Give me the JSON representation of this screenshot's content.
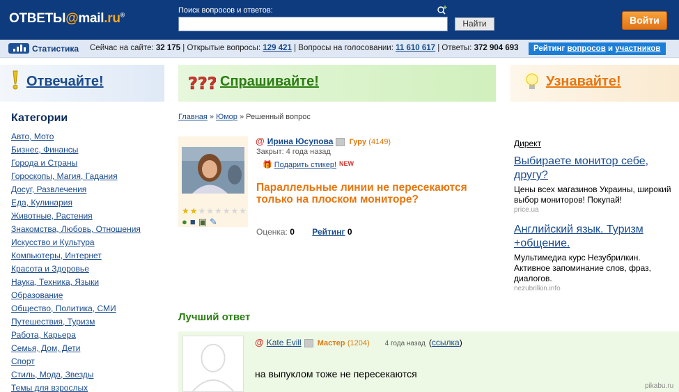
{
  "header": {
    "logo_text": "ОТВЕТЫ",
    "logo_at": "@",
    "logo_mail": "mail",
    "logo_ru": ".ru",
    "logo_reg": "®",
    "search_label": "Поиск вопросов и ответов:",
    "search_value": "",
    "search_button": "Найти",
    "login_button": "Войти"
  },
  "statbar": {
    "title": "Статистика",
    "online_label": "Сейчас на сайте:",
    "online_value": "32 175",
    "open_label": "Открытые вопросы:",
    "open_value": "129 421",
    "voting_label": "Вопросы на голосовании:",
    "voting_value": "11 610 617",
    "answers_label": "Ответы:",
    "answers_value": "372 904 693",
    "rating_prefix": "Рейтинг",
    "rating_questions": "вопросов",
    "rating_and": "и",
    "rating_users": "участников"
  },
  "banners": {
    "answer": "Отвечайте!",
    "ask": "Спрашивайте!",
    "learn": "Узнавайте!"
  },
  "sidebar": {
    "title": "Категории",
    "items": [
      "Авто, Мото",
      "Бизнес, Финансы",
      "Города и Страны",
      "Гороскопы, Магия, Гадания",
      "Досуг, Развлечения",
      "Еда, Кулинария",
      "Животные, Растения",
      "Знакомства, Любовь, Отношения",
      "Искусство и Культура",
      "Компьютеры, Интернет",
      "Красота и Здоровье",
      "Наука, Техника, Языки",
      "Образование",
      "Общество, Политика, СМИ",
      "Путешествия, Туризм",
      "Работа, Карьера",
      "Семья, Дом, Дети",
      "Спорт",
      "Стиль, Мода, Звезды",
      "Темы для взрослых"
    ]
  },
  "breadcrumb": {
    "home": "Главная",
    "sep1": " » ",
    "section": "Юмор",
    "sep2": " » ",
    "current": "Решенный вопрос"
  },
  "question": {
    "author": "Ирина Юсупова",
    "rank": "Гуру",
    "points": "(4149)",
    "closed": "Закрыт: 4 года назад",
    "sticker_link": "Подарить стикер!",
    "sticker_new": "NEW",
    "text": "Параллельные линии не пересекаются только на плоском мониторе?",
    "score_label": "Оценка:",
    "score_value": "0",
    "rating_label": "Рейтинг",
    "rating_value": "0",
    "stars_filled": 2,
    "stars_total": 8
  },
  "direct": {
    "label": "Директ",
    "ads": [
      {
        "title": "Выбираете монитор себе, другу?",
        "desc": "Цены всех магазинов Украины, широкий выбор мониторов! Покупай!",
        "src": "price.ua"
      },
      {
        "title": "Английский язык. Туризм +общение.",
        "desc": "Мультимедиа курс Незубрилкин. Активное запоминание слов, фраз, диалогов.",
        "src": "nezubrilkin.info"
      }
    ]
  },
  "best_answer": {
    "title": "Лучший ответ",
    "author": "Kate Evill",
    "rank": "Мастер",
    "points": "(1204)",
    "when": "4 года назад",
    "link_open": "(",
    "link": "ссылка",
    "link_close": ")",
    "text": "на выпуклом тоже не пересекаются"
  },
  "watermark": "pikabu.ru",
  "colors": {
    "header_bg": "#0e3b7d",
    "accent_orange": "#e8760f",
    "green": "#2b7d12",
    "link": "#1a4b8c"
  }
}
